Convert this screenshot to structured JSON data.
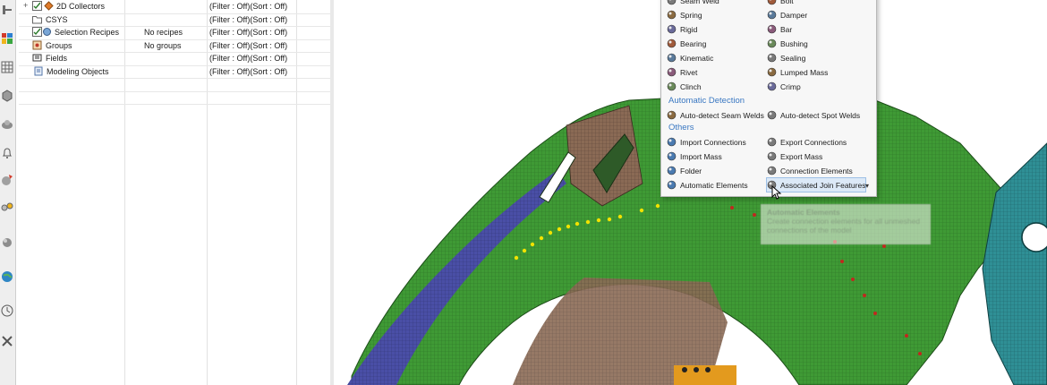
{
  "toolbar_icons": [
    "wrench-cross-icon",
    "grid-icon",
    "cube-icon",
    "part-icon",
    "bell-icon",
    "connector-icon",
    "rigid-icon",
    "sphere-icon",
    "globe-icon",
    "clock-icon",
    "tools-icon",
    "folder-tree-icon"
  ],
  "tree": {
    "rows": [
      {
        "label": "2D Collectors",
        "count": "",
        "filter": "(Filter : Off)(Sort : Off)",
        "icon": "collector-icon",
        "expandable": true,
        "checked": true
      },
      {
        "label": "CSYS",
        "count": "",
        "filter": "(Filter : Off)(Sort : Off)",
        "icon": "folder-icon",
        "expandable": false,
        "checked": false
      },
      {
        "label": "Selection Recipes",
        "count": "No recipes",
        "filter": "(Filter : Off)(Sort : Off)",
        "icon": "recipe-icon",
        "expandable": false,
        "checked": true
      },
      {
        "label": "Groups",
        "count": "No groups",
        "filter": "(Filter : Off)(Sort : Off)",
        "icon": "groups-icon",
        "expandable": false,
        "checked": false
      },
      {
        "label": "Fields",
        "count": "",
        "filter": "(Filter : Off)(Sort : Off)",
        "icon": "fields-icon",
        "expandable": false,
        "checked": false
      },
      {
        "label": "Modeling Objects",
        "count": "",
        "filter": "(Filter : Off)(Sort : Off)",
        "icon": "modeling-icon",
        "expandable": false,
        "checked": false
      }
    ]
  },
  "menu": {
    "connections": [
      {
        "left": "Seam Weld",
        "right": "Bolt"
      },
      {
        "left": "Spring",
        "right": "Damper"
      },
      {
        "left": "Rigid",
        "right": "Bar"
      },
      {
        "left": "Bearing",
        "right": "Bushing"
      },
      {
        "left": "Kinematic",
        "right": "Sealing"
      },
      {
        "left": "Rivet",
        "right": "Lumped Mass"
      },
      {
        "left": "Clinch",
        "right": "Crimp"
      }
    ],
    "section_auto": "Automatic Detection",
    "auto": [
      {
        "left": "Auto-detect Seam Welds",
        "right": "Auto-detect Spot Welds"
      }
    ],
    "section_others": "Others",
    "others": [
      {
        "left": "Import Connections",
        "right": "Export Connections"
      },
      {
        "left": "Import Mass",
        "right": "Export Mass"
      },
      {
        "left": "Folder",
        "right": "Connection Elements"
      },
      {
        "left": "Automatic Elements",
        "right": "Associated Join Features"
      }
    ]
  },
  "tooltip": {
    "title": "Automatic Elements",
    "text": "Create connection elements for all unmeshed connections of the model"
  },
  "colors": {
    "accent": "#3a78c2",
    "mesh_green": "#3e9a35",
    "mesh_blue": "#4a4fa6",
    "mesh_teal": "#2f8f95",
    "mesh_brown": "#8a6a55",
    "weld_yellow": "#f2e200",
    "weld_red": "#c0281e"
  }
}
